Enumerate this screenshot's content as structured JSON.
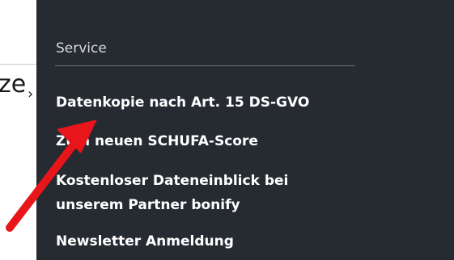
{
  "left_fragment": {
    "text": "ze"
  },
  "service_menu": {
    "title": "Service",
    "items": [
      {
        "label": "Datenkopie nach Art. 15 DS-GVO"
      },
      {
        "label": "Zum neuen SCHUFA-Score"
      },
      {
        "label": "Kostenloser Dateneinblick bei unserem Partner bonify"
      },
      {
        "label": "Newsletter Anmeldung"
      }
    ]
  },
  "annotation": {
    "arrow_color": "#e8161b",
    "arrow_icon": "red-arrow-icon"
  },
  "colors": {
    "panel_bg": "#262a31",
    "text": "#ffffff",
    "muted_text": "#d7d9dc"
  }
}
